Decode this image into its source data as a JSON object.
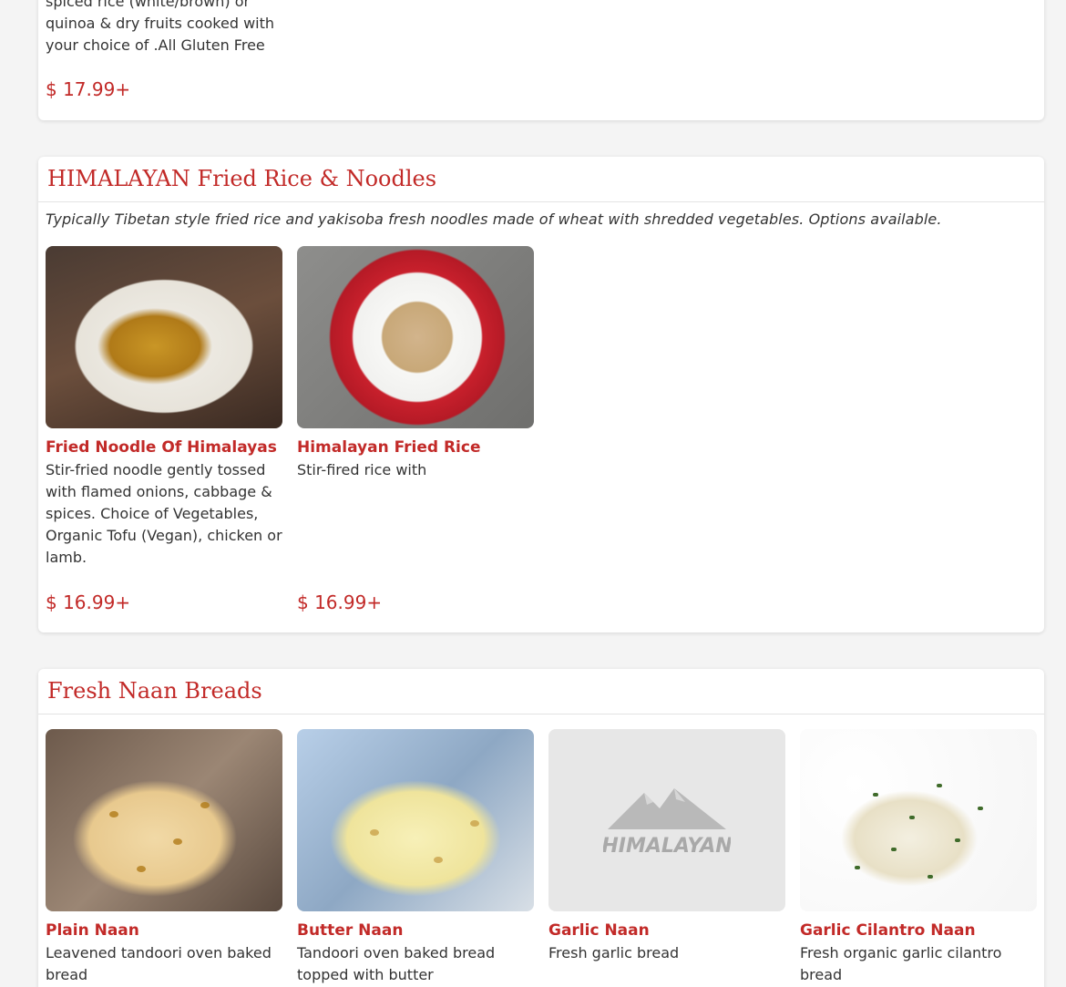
{
  "top_section": {
    "item": {
      "desc_lines": "spiced rice (white/brown) or quinoa & dry fruits cooked with your choice of .All Gluten Free",
      "price": "$ 17.99+"
    }
  },
  "fried_rice_section": {
    "title": "HIMALAYAN Fried Rice & Noodles",
    "description": "Typically Tibetan style fried rice and yakisoba fresh noodles made of wheat with shredded vegetables. Options available.",
    "items": [
      {
        "name": "Fried Noodle Of Himalayas",
        "desc": "Stir-fried noodle gently tossed with flamed onions, cabbage & spices. Choice of Vegetables, Organic Tofu (Vegan), chicken or lamb.",
        "price": "$ 16.99+"
      },
      {
        "name": "Himalayan Fried Rice",
        "desc": "Stir-fired rice with",
        "price": "$ 16.99+"
      }
    ]
  },
  "naan_section": {
    "title": "Fresh Naan Breads",
    "items": [
      {
        "name": "Plain Naan",
        "desc": "Leavened tandoori oven baked bread"
      },
      {
        "name": "Butter Naan",
        "desc": "Tandoori oven baked bread topped with butter"
      },
      {
        "name": "Garlic Naan",
        "desc": "Fresh garlic bread",
        "placeholder_logo": "HIMALAYAN"
      },
      {
        "name": "Garlic Cilantro Naan",
        "desc": "Fresh organic garlic cilantro bread"
      }
    ]
  },
  "colors": {
    "accent": "#c22a28",
    "background": "#f4f4f4",
    "card": "#ffffff"
  }
}
